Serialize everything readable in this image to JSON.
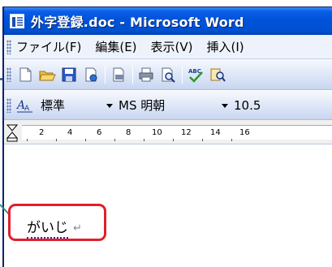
{
  "window": {
    "title": "外字登録.doc - Microsoft Word"
  },
  "menu": {
    "items": [
      "ファイル(F)",
      "編集(E)",
      "表示(V)",
      "挿入(I)"
    ]
  },
  "toolbar": {
    "buttons": [
      "new-document",
      "open",
      "save",
      "permission",
      "print-preview",
      "print",
      "print-preview-zoom",
      "spelling",
      "research"
    ]
  },
  "formatting": {
    "style_value": "標準",
    "font_value": "MS 明朝",
    "size_value": "10.5"
  },
  "ruler": {
    "labels": [
      "2",
      "4",
      "6",
      "8",
      "10",
      "12",
      "14",
      "16"
    ]
  },
  "document": {
    "text": "がいじ",
    "paragraph_mark": "↵"
  },
  "colors": {
    "titlebar": "#0054e3",
    "highlight": "#e0202a"
  }
}
